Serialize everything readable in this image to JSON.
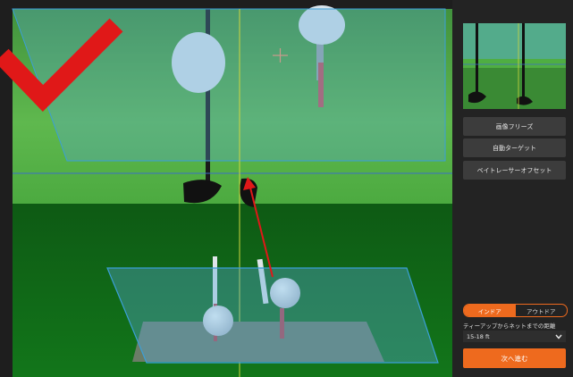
{
  "sidebar": {
    "buttons": [
      {
        "label": "画像フリーズ"
      },
      {
        "label": "自動ターゲット"
      },
      {
        "label": "ベイトレーサーオフセット"
      }
    ],
    "location_toggle": {
      "options": [
        "インドア",
        "アウトドア"
      ],
      "selected": "インドア"
    },
    "distance": {
      "label": "ティーアップからネットまでの距離",
      "value": "15-18 ft"
    },
    "next_label": "次へ進む"
  },
  "colors": {
    "accent": "#ee6a1e",
    "check_mark": "#e01818",
    "overlay": "#3b9fd8"
  },
  "icons": [
    "check-mark-icon",
    "crosshair-plus-icon",
    "direction-arrow-icon",
    "chevron-down-icon"
  ]
}
